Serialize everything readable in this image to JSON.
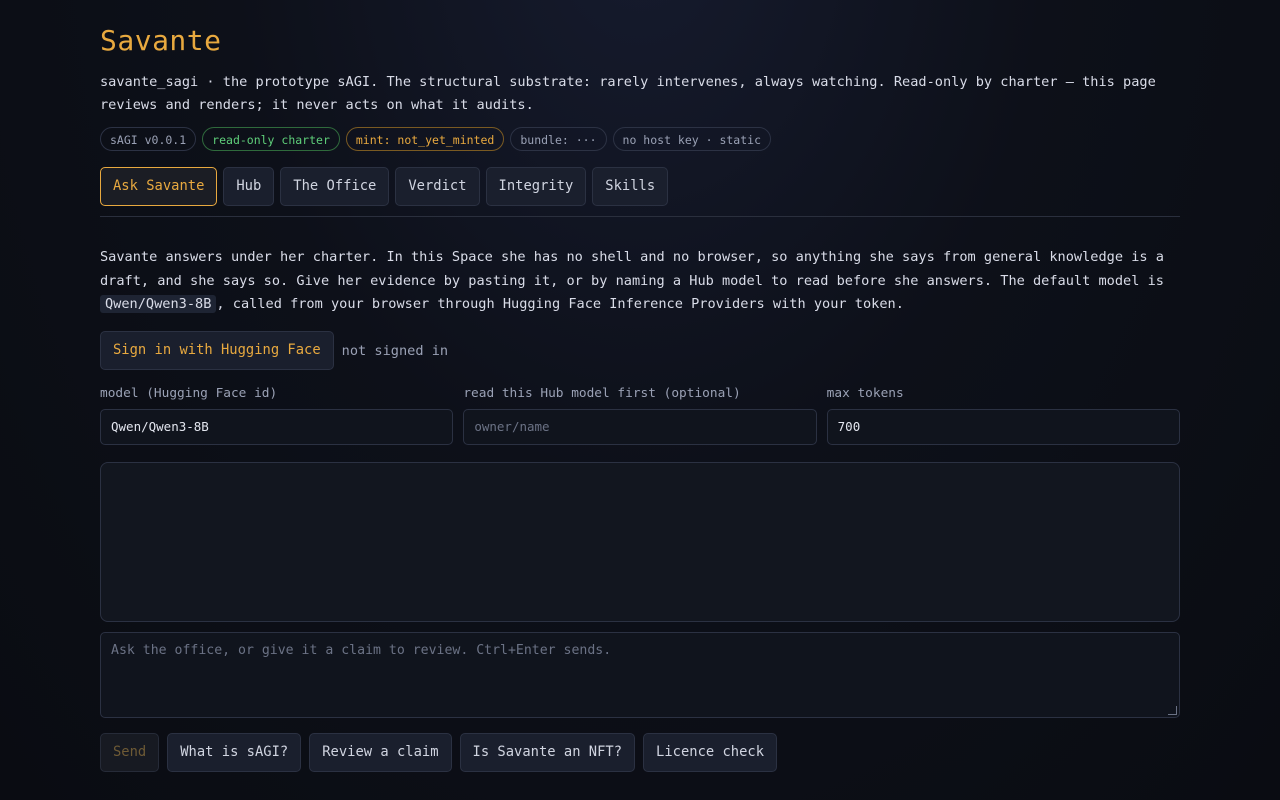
{
  "app": {
    "title": "Savante",
    "subtitle": "savante_sagi · the prototype sAGI. The structural substrate: rarely intervenes, always watching. Read-only by charter — this page reviews and renders; it never acts on what it audits."
  },
  "badges": [
    {
      "label": "sAGI v0.0.1",
      "tone": "neutral"
    },
    {
      "label": "read-only charter",
      "tone": "green"
    },
    {
      "label": "mint: not_yet_minted",
      "tone": "amber"
    },
    {
      "label": "bundle: ···",
      "tone": "neutral"
    },
    {
      "label": "no host key · static",
      "tone": "neutral"
    }
  ],
  "tabs": [
    {
      "label": "Ask Savante",
      "active": true
    },
    {
      "label": "Hub",
      "active": false
    },
    {
      "label": "The Office",
      "active": false
    },
    {
      "label": "Verdict",
      "active": false
    },
    {
      "label": "Integrity",
      "active": false
    },
    {
      "label": "Skills",
      "active": false
    }
  ],
  "intro": {
    "part1": "Savante answers under her charter. In this Space she has no shell and no browser, so anything she says from general knowledge is a draft, and she says so. Give her evidence by pasting it, or by naming a Hub model to read before she answers. The default model is ",
    "model_code": "Qwen/Qwen3-8B",
    "part2": ", called from your browser through Hugging Face Inference Providers with your token."
  },
  "auth": {
    "signin_label": "Sign in with Hugging Face",
    "status": "not signed in"
  },
  "fields": {
    "model": {
      "label": "model (Hugging Face id)",
      "value": "Qwen/Qwen3-8B"
    },
    "hub_model": {
      "label": "read this Hub model first (optional)",
      "placeholder": "owner/name"
    },
    "max_tokens": {
      "label": "max tokens",
      "value": "700"
    }
  },
  "prompt": {
    "placeholder": "Ask the office, or give it a claim to review. Ctrl+Enter sends."
  },
  "actions": {
    "send": "Send",
    "suggestions": [
      "What is sAGI?",
      "Review a claim",
      "Is Savante an NFT?",
      "Licence check"
    ]
  },
  "colors": {
    "accent": "#e8a93f",
    "green": "#5fcf7a",
    "background": "#0d1019"
  }
}
